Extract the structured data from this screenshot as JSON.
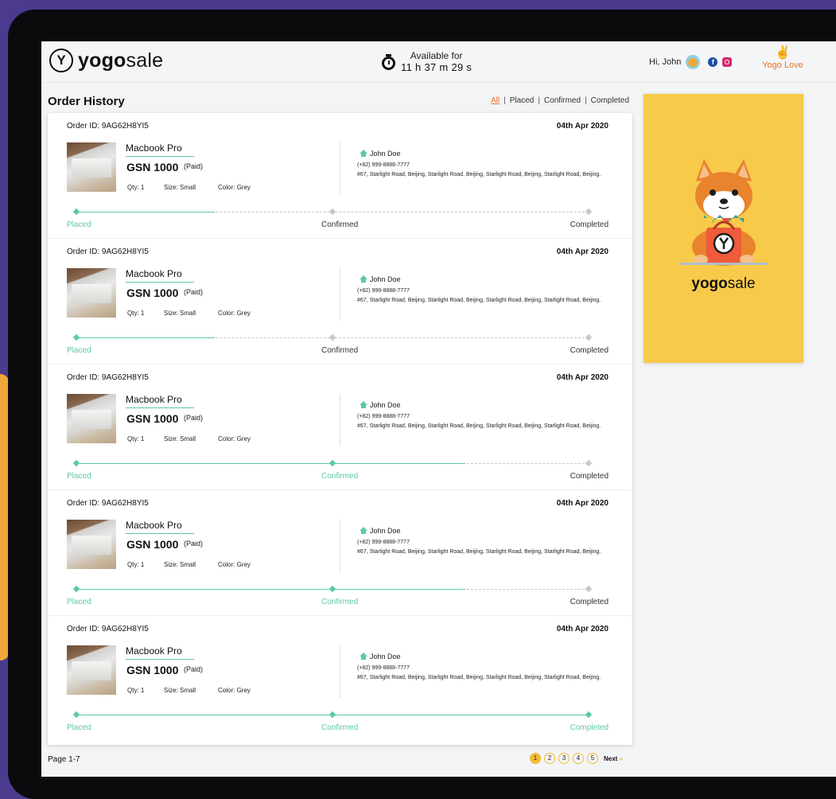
{
  "brand": {
    "logo_letter": "Y",
    "name_bold": "yogo",
    "name_light": "sale"
  },
  "header": {
    "timer_label": "Available for",
    "timer_value": "11 h  37 m  29 s",
    "greeting": "Hi, John",
    "fb_glyph": "f",
    "love_hand": "✌",
    "love_label": "Yogo Love"
  },
  "order_history": {
    "title": "Order History",
    "filters": [
      "All",
      "Placed",
      "Confirmed",
      "Completed"
    ],
    "active_filter": "All"
  },
  "orders": [
    {
      "id_label": "Order ID: 9AG62H8YI5",
      "date": "04th Apr 2020",
      "product": "Macbook Pro",
      "price": "GSN 1000",
      "payment": "(Paid)",
      "qty": "Qty: 1",
      "size": "Size: Small",
      "color": "Color: Grey",
      "customer": "John Doe",
      "phone": "(+82) 999-8888-7777",
      "address": "#67, Starlight Road, Beijing, Starlight Road, Beijing, Starlight Road, Beijing,  Starlight Road, Beijing.",
      "steps": [
        "Placed",
        "Confirmed",
        "Completed"
      ],
      "status_index": 0,
      "progress": 0.27
    },
    {
      "id_label": "Order ID: 9AG62H8YI5",
      "date": "04th Apr 2020",
      "product": "Macbook Pro",
      "price": "GSN 1000",
      "payment": "(Paid)",
      "qty": "Qty: 1",
      "size": "Size: Small",
      "color": "Color: Grey",
      "customer": "John Doe",
      "phone": "(+82) 999-8888-7777",
      "address": "#67, Starlight Road, Beijing, Starlight Road, Beijing, Starlight Road, Beijing,  Starlight Road, Beijing.",
      "steps": [
        "Placed",
        "Confirmed",
        "Completed"
      ],
      "status_index": 0,
      "progress": 0.27
    },
    {
      "id_label": "Order ID: 9AG62H8YI5",
      "date": "04th Apr 2020",
      "product": "Macbook Pro",
      "price": "GSN 1000",
      "payment": "(Paid)",
      "qty": "Qty: 1",
      "size": "Size: Small",
      "color": "Color: Grey",
      "customer": "John Doe",
      "phone": "(+82) 999-8888-7777",
      "address": "#67, Starlight Road, Beijing, Starlight Road, Beijing, Starlight Road, Beijing,  Starlight Road, Beijing.",
      "steps": [
        "Placed",
        "Confirmed",
        "Completed"
      ],
      "status_index": 1,
      "progress": 0.76
    },
    {
      "id_label": "Order ID: 9AG62H8YI5",
      "date": "04th Apr 2020",
      "product": "Macbook Pro",
      "price": "GSN 1000",
      "payment": "(Paid)",
      "qty": "Qty: 1",
      "size": "Size: Small",
      "color": "Color: Grey",
      "customer": "John Doe",
      "phone": "(+82) 999-8888-7777",
      "address": "#67, Starlight Road, Beijing, Starlight Road, Beijing, Starlight Road, Beijing,  Starlight Road, Beijing.",
      "steps": [
        "Placed",
        "Confirmed",
        "Completed"
      ],
      "status_index": 1,
      "progress": 0.76
    },
    {
      "id_label": "Order ID: 9AG62H8YI5",
      "date": "04th Apr 2020",
      "product": "Macbook Pro",
      "price": "GSN 1000",
      "payment": "(Paid)",
      "qty": "Qty: 1",
      "size": "Size: Small",
      "color": "Color: Grey",
      "customer": "John Doe",
      "phone": "(+82) 999-8888-7777",
      "address": "#67, Starlight Road, Beijing, Starlight Road, Beijing, Starlight Road, Beijing,  Starlight Road, Beijing.",
      "steps": [
        "Placed",
        "Confirmed",
        "Completed"
      ],
      "status_index": 2,
      "progress": 1.0
    }
  ],
  "pagination": {
    "label": "Page 1-7",
    "pages": [
      "1",
      "2",
      "3",
      "4",
      "5"
    ],
    "active": "1",
    "next_label": "Next",
    "next_arrow": "»"
  },
  "promo": {
    "name_bold": "yogo",
    "name_light": "sale"
  },
  "colors": {
    "accent_green": "#5cc9a7",
    "accent_orange": "#e8722b",
    "promo_yellow": "#f8ca4a",
    "pager_yellow": "#f3bc35"
  },
  "icons": [
    "timer-icon",
    "avatar",
    "facebook-icon",
    "instagram-icon",
    "peace-hand-icon",
    "home-icon",
    "mascot-dog"
  ]
}
